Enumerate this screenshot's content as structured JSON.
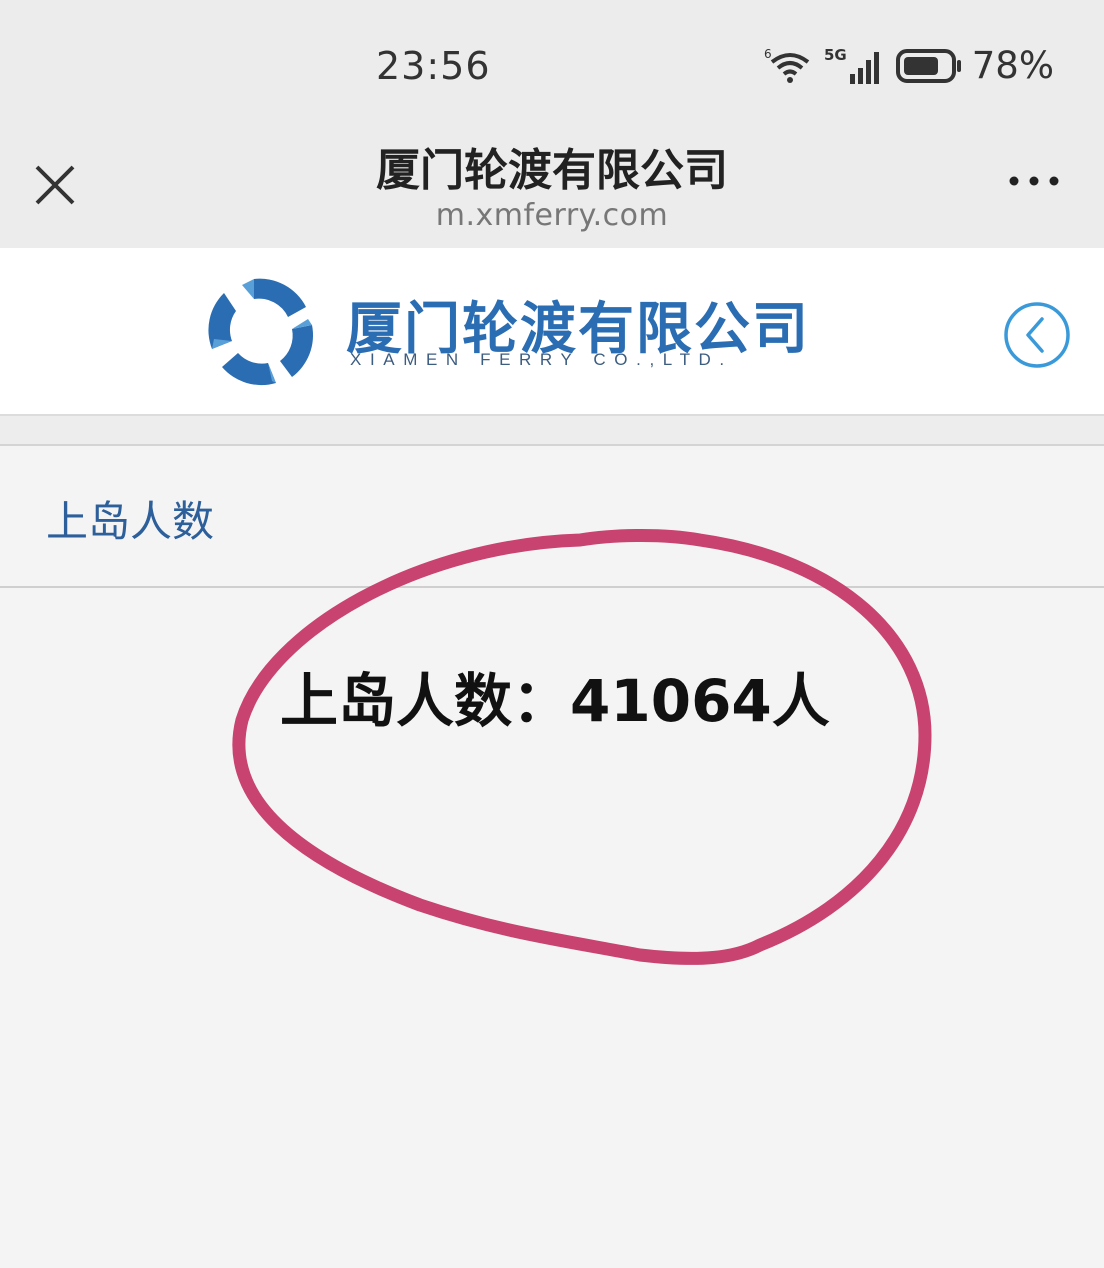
{
  "status_bar": {
    "time": "23:56",
    "network_label": "5G",
    "wifi_label": "6",
    "battery_percent": "78%",
    "battery_level": 0.78
  },
  "browser": {
    "title": "厦门轮渡有限公司",
    "url": "m.xmferry.com",
    "close_icon": "close-icon",
    "more_icon": "more-dots-icon"
  },
  "site_header": {
    "logo_cn": "厦门轮渡有限公司",
    "logo_en": "XIAMEN FERRY CO.,LTD.",
    "brand_color": "#2a6db3",
    "back_icon": "chevron-left-circle-icon"
  },
  "section": {
    "title": "上岛人数"
  },
  "content": {
    "count_text": "上岛人数：41064人"
  },
  "annotation": {
    "color": "#c8436f"
  }
}
